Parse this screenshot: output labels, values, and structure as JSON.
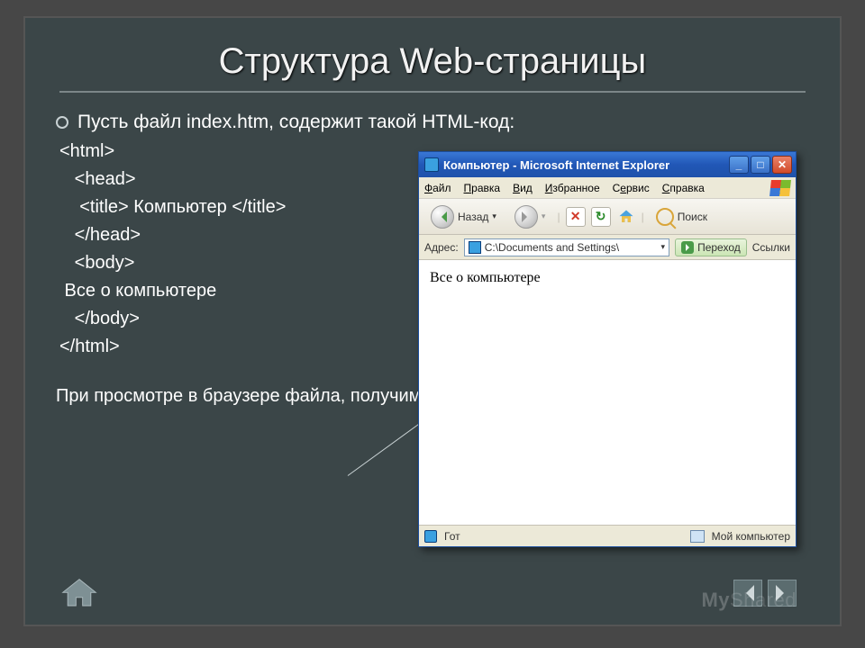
{
  "slide": {
    "title": "Структура Web-страницы",
    "bullet": "Пусть  файл index.htm, содержит такой HTML-код:",
    "code": {
      "l1": "<html>",
      "l2": "   <head>",
      "l3": "    <title> Компьютер </title>",
      "l4": "   </head>",
      "l5": "   <body>",
      "l6": " Все о компьютере",
      "l7": "   </body>",
      "l8": "</html>"
    },
    "note": "При просмотре в браузере файла, получим следующий вид"
  },
  "browser": {
    "title": "Компьютер - Microsoft Internet Explorer",
    "menu": {
      "file": "Файл",
      "edit": "Правка",
      "view": "Вид",
      "fav": "Избранное",
      "svc": "Сервис",
      "help": "Справка"
    },
    "toolbar": {
      "back": "Назад",
      "search": "Поиск"
    },
    "addr": {
      "label": "Адрес:",
      "path": "C:\\Documents and Settings\\",
      "go": "Переход",
      "links": "Ссылки"
    },
    "page_text": "Все о компьютере",
    "status": {
      "left": "Гот",
      "right": "Мой компьютер"
    }
  },
  "watermark": "MyShared"
}
